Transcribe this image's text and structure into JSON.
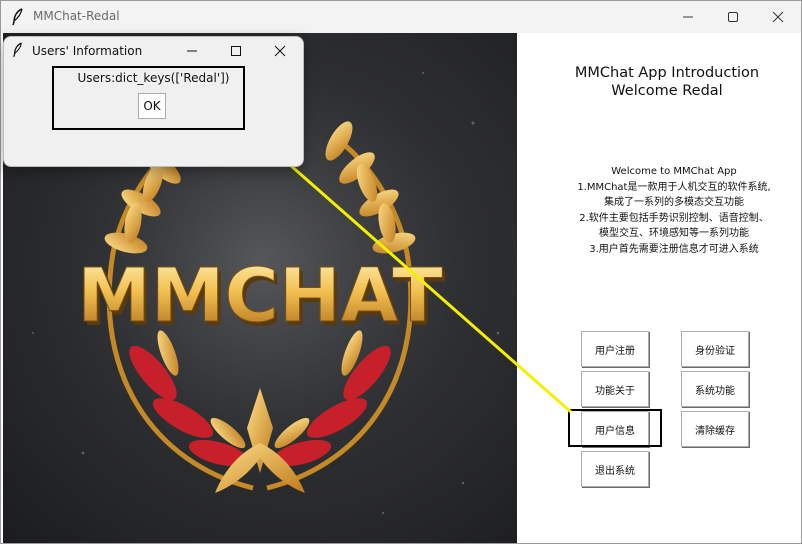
{
  "main_window": {
    "title": "MMChat-Redal",
    "controls": {
      "minimize": "minimize",
      "maximize": "maximize",
      "close": "close"
    }
  },
  "logo_image": {
    "text": "MMCHAT",
    "icon": "golden-laurel-wreath-logo"
  },
  "intro": {
    "title_line1": "MMChat App Introduction",
    "title_line2": "Welcome Redal",
    "lines": [
      "Welcome to MMChat App",
      "1.MMChat是一款用于人机交互的软件系统,",
      "集成了一系列的多模态交互功能",
      "2.软件主要包括手势识别控制、语音控制、",
      "模型交互、环境感知等一系列功能",
      "3.用户首先需要注册信息才可进入系统"
    ]
  },
  "buttons": {
    "register": "用户注册",
    "verify": "身份验证",
    "about": "功能关于",
    "system": "系统功能",
    "user_info": "用户信息",
    "clear_cache": "清除缓存",
    "exit": "退出系统"
  },
  "dialog": {
    "title": "Users' Information",
    "message": "Users:dict_keys(['Redal'])",
    "ok_label": "OK"
  },
  "colors": {
    "arrow": "#f5f000",
    "gold": "#e0a93a",
    "red_leaf": "#c8202a"
  }
}
